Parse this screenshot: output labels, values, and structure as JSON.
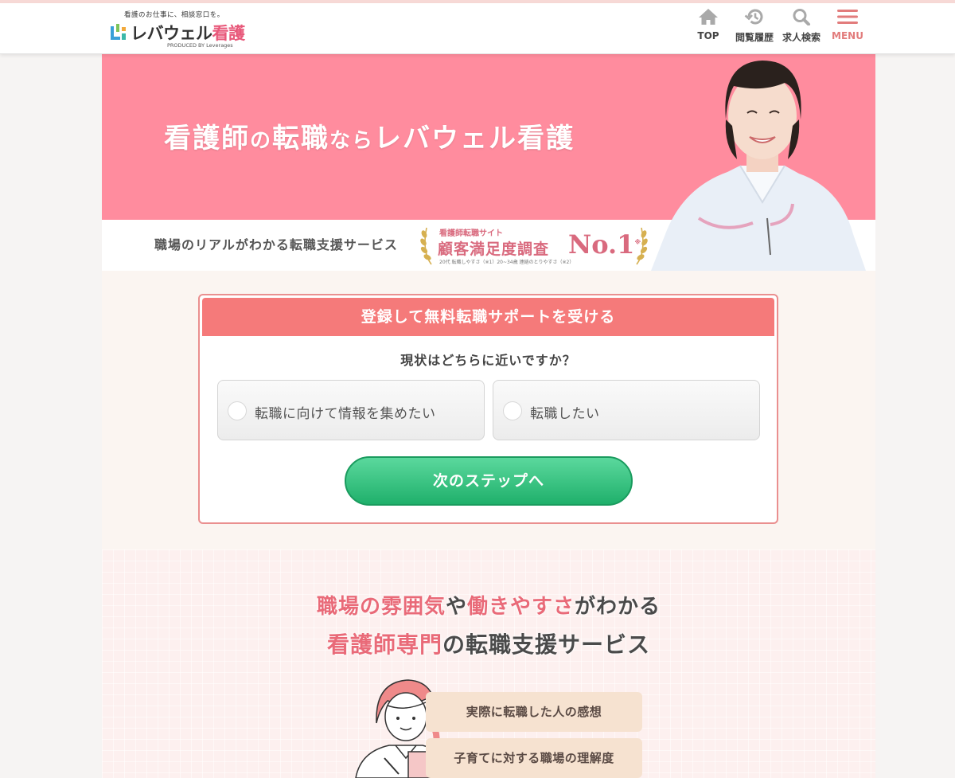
{
  "header": {
    "logo": {
      "tagline": "看護のお仕事に、相談窓口を。",
      "name_main": "レバウェル",
      "name_accent": "看護",
      "produced_by": "PRODUCED BY Leverages"
    },
    "nav": [
      {
        "label": "TOP",
        "icon": "home-icon"
      },
      {
        "label": "閲覧履歴",
        "icon": "history-icon"
      },
      {
        "label": "求人検索",
        "icon": "search-icon"
      },
      {
        "label": "MENU",
        "icon": "hamburger-icon"
      }
    ]
  },
  "hero": {
    "title_part1": "看護師",
    "title_part2": "の",
    "title_part3": "転職",
    "title_part4": "なら",
    "title_part5": "レバウェル看護",
    "subtitle": "職場のリアルがわかる転職支援サービス",
    "award": {
      "caption": "看護師転職サイト",
      "main": "顧客満足度調査",
      "rank": "No.1",
      "mark": "※",
      "note": "20代 転職しやすさ（※1）20~34歳 連絡のとりやすさ（※2）"
    },
    "bg_color": "#ff8c9e"
  },
  "form": {
    "header": "登録して無料転職サポートを受ける",
    "question": "現状はどちらに近いですか？",
    "options": [
      "転職に向けて情報を集めたい",
      "転職したい"
    ],
    "next_button": "次のステップへ",
    "accent_color": "#f57a7a",
    "button_color": "#2cbf78"
  },
  "features": {
    "line1": {
      "hl1": "職場の雰囲気",
      "t1": "や",
      "hl2": "働きやすさ",
      "t2": "がわかる"
    },
    "line2": {
      "hl1": "看護師専門",
      "t1": "の転職支援サービス"
    },
    "items": [
      "実際に転職した人の感想",
      "子育てに対する職場の理解度"
    ],
    "highlight_color": "#e96a78"
  }
}
